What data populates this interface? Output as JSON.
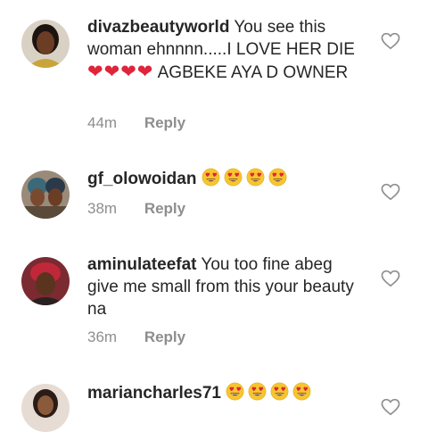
{
  "comments": [
    {
      "username": "divazbeautyworld",
      "text_part1": "You see this woman ehnnnn.....I LOVE HER DIE",
      "emoji_part": "❤❤❤❤",
      "text_part2": "AGBEKE AYA D OWNER",
      "time": "44m",
      "reply_label": "Reply"
    },
    {
      "username": "gf_olowoidan",
      "emoji_count": 4,
      "emoji_name": "heart-eyes-emoji",
      "time": "38m",
      "reply_label": "Reply"
    },
    {
      "username": "aminulateefat",
      "text": "You too fine abeg give me small from this your beauty na",
      "time": "36m",
      "reply_label": "Reply"
    },
    {
      "username": "mariancharles71",
      "emoji_count": 4,
      "emoji_name": "heart-eyes-emoji"
    }
  ],
  "icons": {
    "like": "heart-outline-icon"
  },
  "colors": {
    "text": "#262626",
    "meta": "#8e8e8e",
    "red_heart": "#e0243a",
    "emoji_yellow": "#f7c52e"
  }
}
